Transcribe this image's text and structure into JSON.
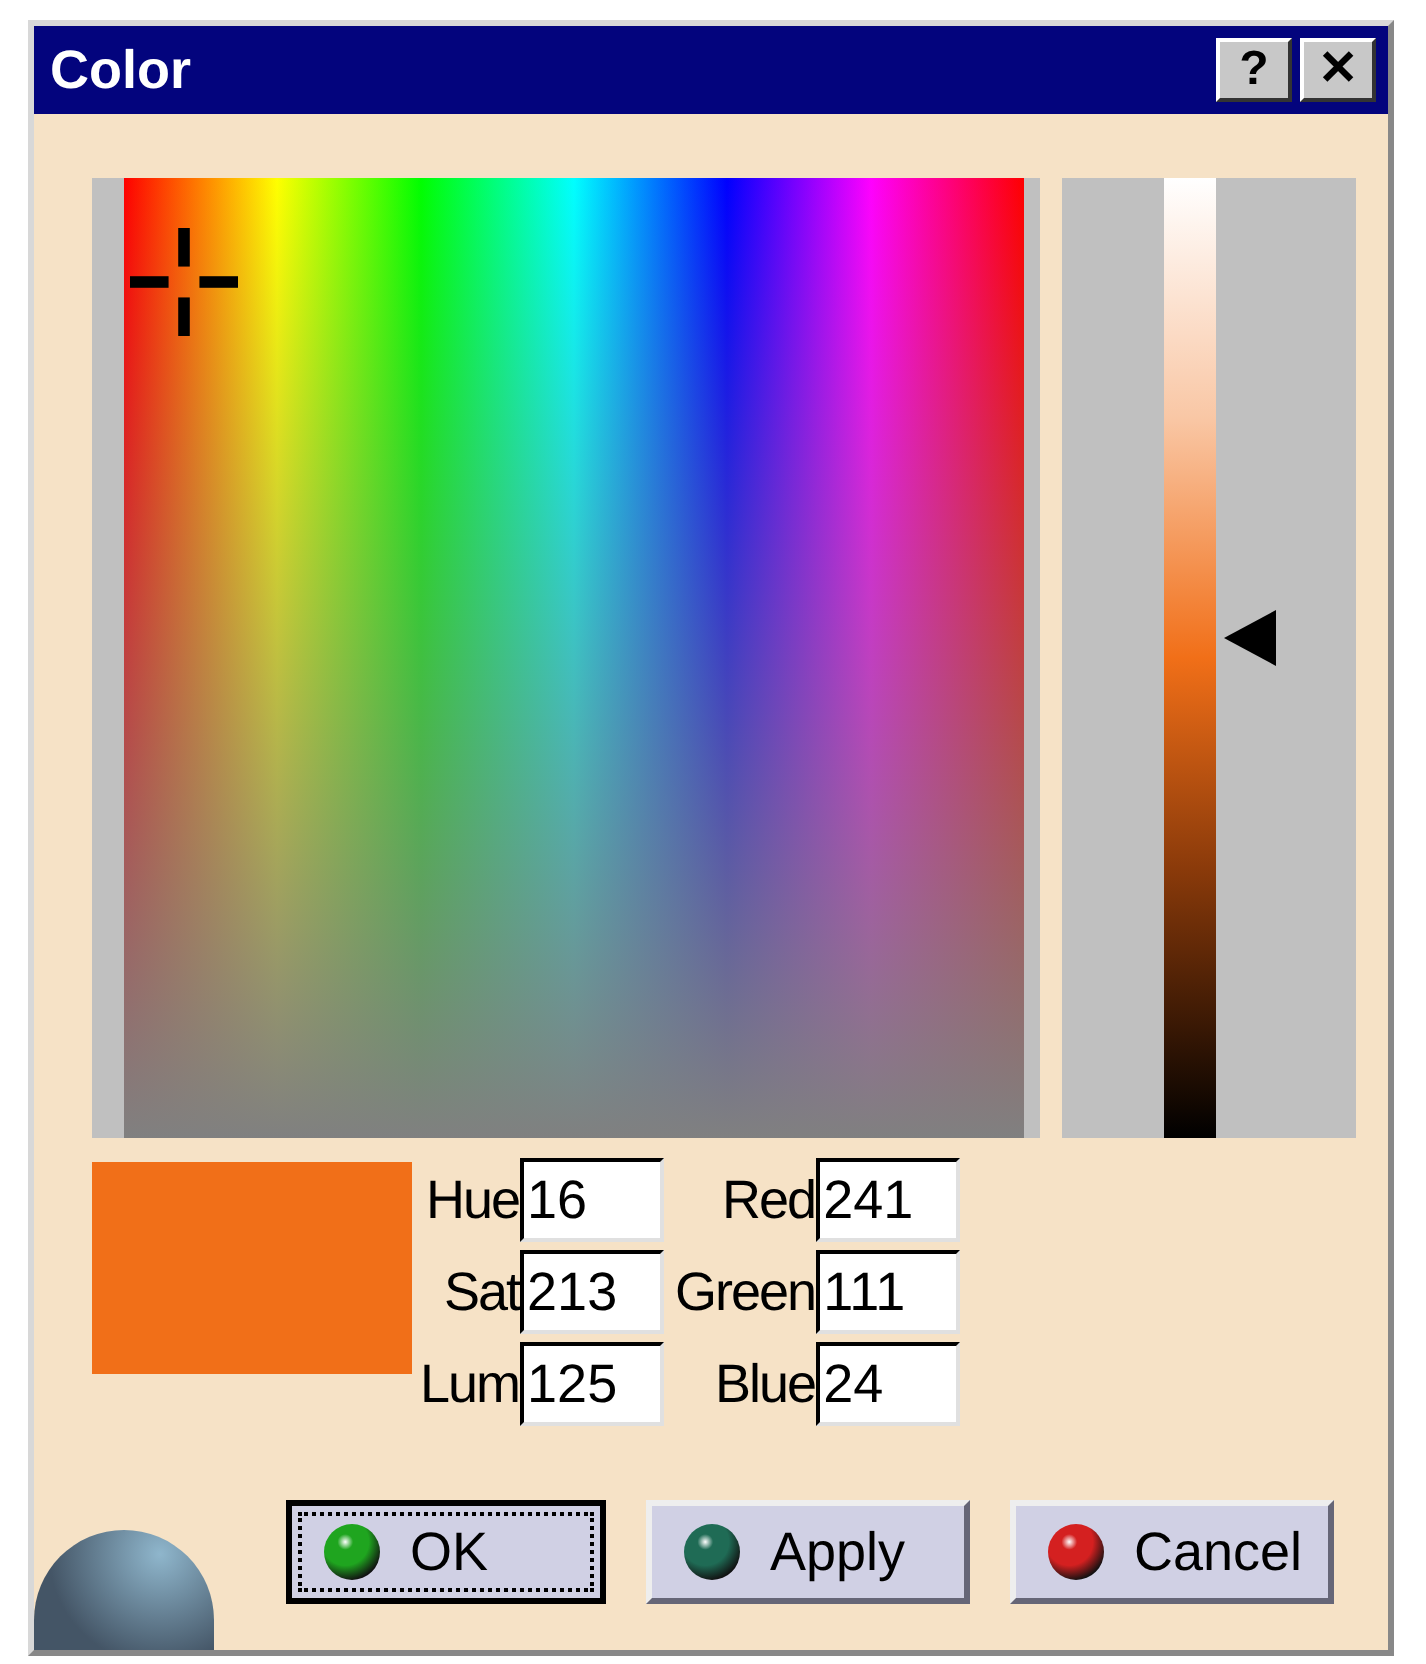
{
  "window": {
    "title": "Color",
    "help": "?",
    "close": "✕"
  },
  "luminance_slider": {
    "level": 0.52
  },
  "preview": {
    "color": "#f16f18"
  },
  "fields": [
    {
      "label": "Hue",
      "value": "16"
    },
    {
      "label": "Red",
      "value": "241"
    },
    {
      "label": "Sat",
      "value": "213"
    },
    {
      "label": "Green",
      "value": "111"
    },
    {
      "label": "Lum",
      "value": "125"
    },
    {
      "label": "Blue",
      "value": "24"
    }
  ],
  "buttons": [
    {
      "label": "OK",
      "focused": true,
      "color": "#1fa51f"
    },
    {
      "label": "Apply",
      "focused": false,
      "color": "#1f6b55"
    },
    {
      "label": "Cancel",
      "focused": false,
      "color": "#d42020"
    }
  ]
}
